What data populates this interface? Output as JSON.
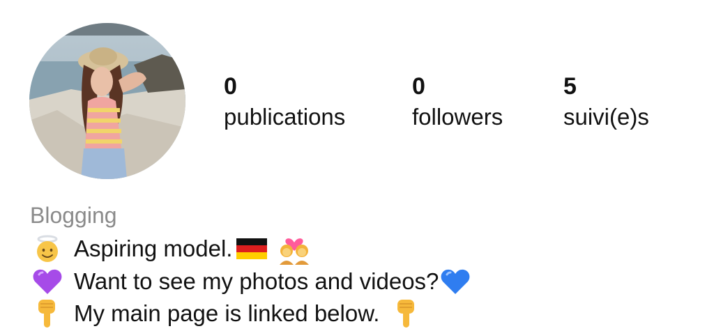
{
  "profile": {
    "avatar_icon": "profile-photo",
    "stats": [
      {
        "value": "0",
        "label": "publications"
      },
      {
        "value": "0",
        "label": "followers"
      },
      {
        "value": "5",
        "label": "suivi(e)s"
      }
    ]
  },
  "bio": {
    "category": "Blogging",
    "lines": [
      {
        "leading_icon": "angel-face-emoji",
        "text": "Aspiring model.",
        "trailing_icons": [
          "germany-flag-emoji",
          "couple-with-heart-emoji"
        ]
      },
      {
        "leading_icon": "purple-heart-emoji",
        "text": "Want to see my photos and videos?",
        "trailing_icons": [
          "blue-heart-emoji"
        ]
      },
      {
        "leading_icon": "pointing-down-emoji",
        "text": "My main page is linked below.",
        "trailing_icons": [
          "pointing-down-emoji"
        ]
      }
    ]
  },
  "colors": {
    "text": "#111111",
    "category_text": "#8a8a8a",
    "background": "#ffffff"
  }
}
